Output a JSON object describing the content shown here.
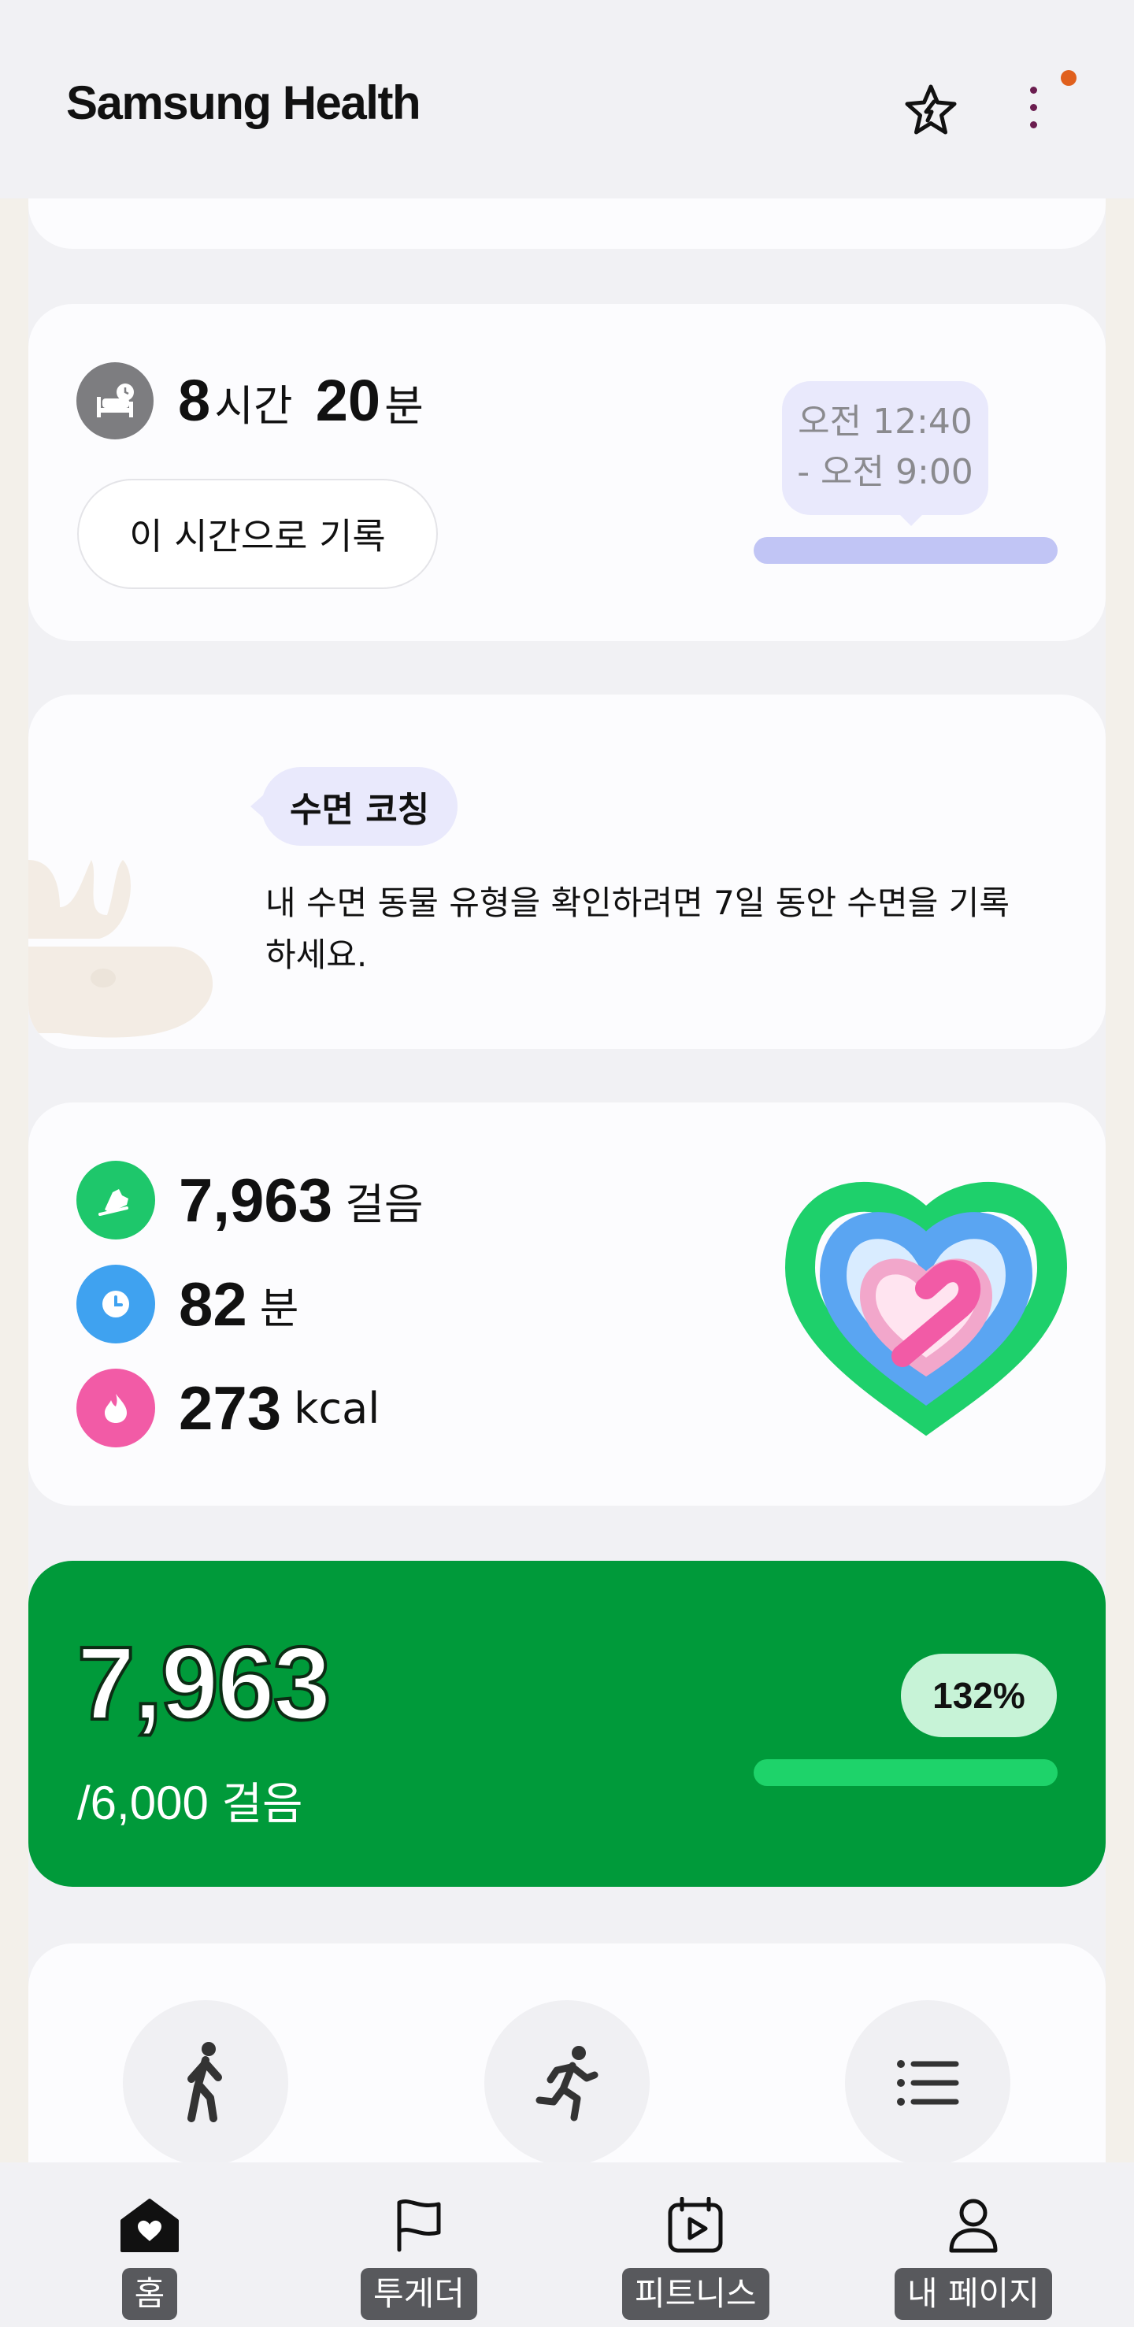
{
  "header": {
    "title": "Samsung Health"
  },
  "sleep": {
    "hours": "8",
    "hours_unit": "시간",
    "minutes": "20",
    "minutes_unit": "분",
    "record_button": "이 시간으로 기록",
    "range_line1": "오전 12:40",
    "range_line2": "- 오전 9:00"
  },
  "coaching": {
    "tag": "수면 코칭",
    "message": "내 수면 동물 유형을 확인하려면 7일 동안 수면을 기록하세요."
  },
  "activity": {
    "steps": "7,963",
    "steps_unit": "걸음",
    "active_minutes": "82",
    "minutes_unit": "분",
    "calories": "273",
    "calories_unit": "kcal"
  },
  "steps_card": {
    "value": "7,963",
    "goal": "/6,000",
    "goal_unit": "걸음",
    "percent": "132%",
    "progress": 1.0,
    "accent": "#009a3a"
  },
  "bottom_nav": [
    {
      "label": "홈",
      "icon": "home-heart-icon"
    },
    {
      "label": "투게더",
      "icon": "flag-icon"
    },
    {
      "label": "피트니스",
      "icon": "calendar-play-icon"
    },
    {
      "label": "내 페이지",
      "icon": "person-icon"
    }
  ]
}
